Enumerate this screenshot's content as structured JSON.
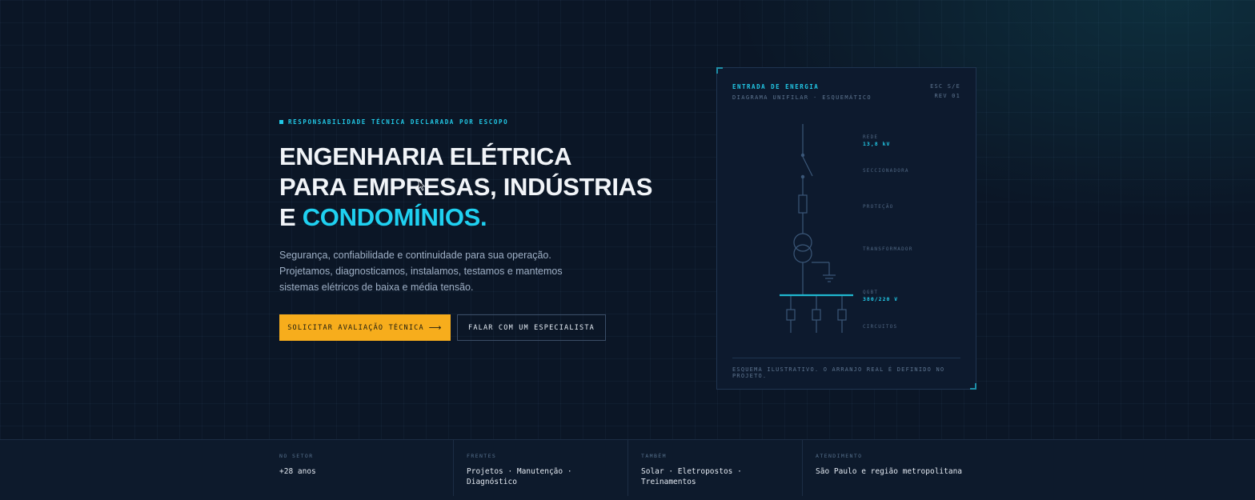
{
  "hero": {
    "eyebrow": "RESPONSABILIDADE TÉCNICA DECLARADA POR ESCOPO",
    "headline_line1": "ENGENHARIA ELÉTRICA",
    "headline_line2": "PARA EMPRESAS, INDÚSTRIAS",
    "headline_line3_prefix": "E",
    "headline_line3_accent": "CONDOMÍNIOS.",
    "lede": "Segurança, confiabilidade e continuidade para sua operação. Projetamos, diagnosticamos, instalamos, testamos e mantemos sistemas elétricos de baixa e média tensão.",
    "cta_primary": "SOLICITAR AVALIAÇÃO TÉCNICA",
    "cta_primary_icon": "arrow-right-icon",
    "cta_secondary": "FALAR COM UM ESPECIALISTA"
  },
  "schematic": {
    "title": "ENTRADA DE ENERGIA",
    "subtitle": "DIAGRAMA UNIFILAR · ESQUEMÁTICO",
    "ref_scale": "ESC S/E",
    "ref_rev": "REV 01",
    "labels": {
      "rede": "REDE",
      "rede_value": "13,8 kV",
      "seccionadora": "SECCIONADORA",
      "protecao": "PROTEÇÃO",
      "transformador": "TRANSFORMADOR",
      "qgbt": "QGBT",
      "qgbt_value": "380/220 V",
      "circuitos": "CIRCUITOS"
    },
    "footnote": "ESQUEMA ILUSTRATIVO. O ARRANJO REAL É DEFINIDO NO PROJETO."
  },
  "stats": [
    {
      "label": "NO SETOR",
      "value": "+28 anos"
    },
    {
      "label": "FRENTES",
      "value_line1": "Projetos · Manutenção ·",
      "value_line2": "Diagnóstico"
    },
    {
      "label": "TAMBÉM",
      "value_line1": "Solar · Eletropostos ·",
      "value_line2": "Treinamentos"
    },
    {
      "label": "ATENDIMENTO",
      "value": "São Paulo e região metropolitana"
    }
  ],
  "colors": {
    "background": "#0b1626",
    "accent_cyan": "#1fd0f0",
    "cta_yellow": "#f7ad1c",
    "text_primary": "#f1f4f8",
    "text_muted": "#9fb0c6"
  }
}
